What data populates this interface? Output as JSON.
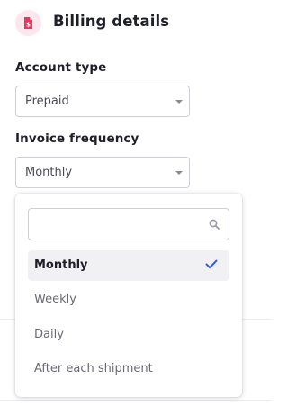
{
  "header": {
    "title": "Billing details",
    "icon": "invoice-icon",
    "icon_color": "#e8365d",
    "icon_bg": "#fde7ec"
  },
  "account_type": {
    "label": "Account type",
    "value": "Prepaid"
  },
  "invoice_frequency": {
    "label": "Invoice frequency",
    "value": "Monthly"
  },
  "dropdown": {
    "search_value": "",
    "search_placeholder": "",
    "options": [
      {
        "label": "Monthly",
        "selected": true
      },
      {
        "label": "Weekly",
        "selected": false
      },
      {
        "label": "Daily",
        "selected": false
      },
      {
        "label": "After each shipment",
        "selected": false
      }
    ],
    "check_color": "#2f5fe0"
  }
}
